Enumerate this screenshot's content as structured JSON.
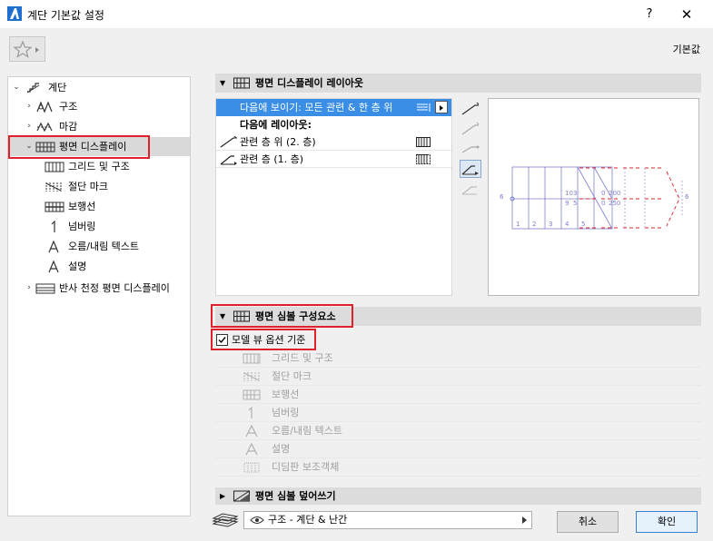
{
  "window": {
    "title": "계단 기본값 설정",
    "help": "?",
    "close": "✕"
  },
  "header": {
    "default_label": "기본값"
  },
  "tree": {
    "items": [
      {
        "label": "계단"
      },
      {
        "label": "구조"
      },
      {
        "label": "마감"
      },
      {
        "label": "평면 디스플레이"
      },
      {
        "label": "그리드 및 구조"
      },
      {
        "label": "절단 마크"
      },
      {
        "label": "보행선"
      },
      {
        "label": "넘버링"
      },
      {
        "label": "오름/내림 텍스트"
      },
      {
        "label": "설명"
      },
      {
        "label": "반사 천정 평면 디스플레이"
      }
    ]
  },
  "plan_layout": {
    "header": "평면 디스플레이 레이아웃",
    "show_on": "다음에 보이기: 모든 관련 & 한 층 위",
    "layout_for": "다음에 레이아웃:",
    "rows": [
      {
        "label": "관련 층 위 (2. 층)"
      },
      {
        "label": "관련 층 (1. 층)"
      }
    ]
  },
  "preview": {
    "labels": [
      "10",
      "3",
      "9",
      "5",
      "0",
      "200",
      "0",
      "250",
      "6",
      "6",
      "1",
      "2",
      "3",
      "4",
      "5"
    ]
  },
  "symbol_components": {
    "header": "평면 심볼 구성요소",
    "checkbox_label": "모델 뷰 옵션 기준",
    "checked": true,
    "items": [
      {
        "label": "그리드 및 구조"
      },
      {
        "label": "절단 마크"
      },
      {
        "label": "보행선"
      },
      {
        "label": "넘버링"
      },
      {
        "label": "오름/내림 텍스트"
      },
      {
        "label": "설명"
      },
      {
        "label": "디딤판 보조객체"
      }
    ]
  },
  "override": {
    "header": "평면 심볼 덮어쓰기"
  },
  "footer": {
    "view_value": "구조 - 계단 & 난간",
    "cancel": "취소",
    "ok": "확인"
  },
  "colors": {
    "selection_blue": "#3a8ee6",
    "highlight_red": "#e0202a"
  }
}
